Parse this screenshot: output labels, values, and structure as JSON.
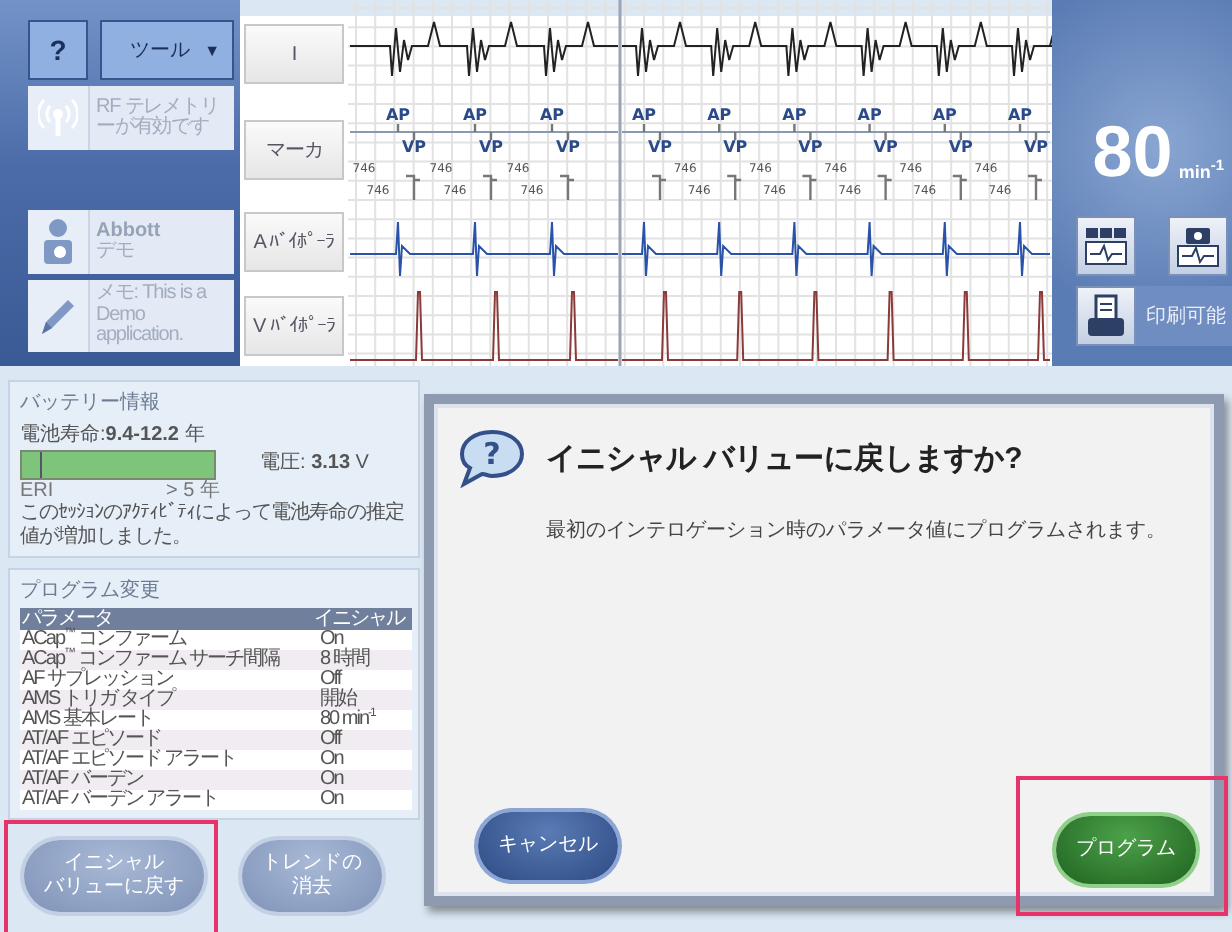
{
  "sidebar": {
    "help_button": "?",
    "tools_menu": {
      "label": "ツール",
      "caret": "▼"
    },
    "items": [
      {
        "kind": "telemetry",
        "text": "RF テレメトリーが有効です"
      },
      {
        "kind": "patient",
        "title": "Abbott",
        "text": "デモ"
      },
      {
        "kind": "note",
        "text": "メモ: This is a Demo application."
      }
    ]
  },
  "ecg": {
    "channels": [
      {
        "label": "I",
        "kind": "surface"
      },
      {
        "label": "マーカ",
        "kind": "marker"
      },
      {
        "label": "A ﾊﾞｲﾎﾟｰﾗ",
        "kind": "atrial"
      },
      {
        "label": "V ﾊﾞｲﾎﾟｰﾗ",
        "kind": "ventricular"
      }
    ],
    "segments": [
      {
        "beats": [
          {
            "atrial_marker": "AP",
            "ventricular_marker": "VP",
            "intervals": [
              "746",
              "746"
            ]
          },
          {
            "atrial_marker": "AP",
            "ventricular_marker": "VP",
            "intervals": [
              "746",
              "746"
            ]
          },
          {
            "atrial_marker": "AP",
            "ventricular_marker": "VP",
            "intervals": [
              "746",
              "746"
            ]
          }
        ]
      },
      {
        "beats": [
          {
            "atrial_marker": "AP",
            "ventricular_marker": "VP"
          },
          {
            "atrial_marker": "AP",
            "ventricular_marker": "VP",
            "intervals": [
              "746",
              "746"
            ]
          },
          {
            "atrial_marker": "AP",
            "ventricular_marker": "VP",
            "intervals": [
              "746",
              "746"
            ]
          },
          {
            "atrial_marker": "AP",
            "ventricular_marker": "VP",
            "intervals": [
              "746",
              "746"
            ]
          },
          {
            "atrial_marker": "AP",
            "ventricular_marker": "VP",
            "intervals": [
              "746",
              "746"
            ]
          },
          {
            "atrial_marker": "AP",
            "ventricular_marker": "VP",
            "intervals": [
              "746",
              "746"
            ]
          }
        ]
      }
    ]
  },
  "rate": {
    "value": "80",
    "unit": "min$^{-1}$"
  },
  "print": {
    "label": "印刷可能"
  },
  "battery": {
    "title": "バッテリー情報",
    "longevity": "電池寿命:**9.4-12.2** 年",
    "level": 1,
    "scale_min": "ERI",
    "scale_max": "> 5 年",
    "voltage": "電圧: **3.13** V",
    "note": "このｾｯｼｮﾝのｱｸﾃｨﾋﾞﾃｨによって電池寿命の推定値が増加しました。"
  },
  "program_changes": {
    "title": "プログラム変更",
    "columns": [
      "パラメータ",
      "イニシャル"
    ],
    "rows": [
      [
        "ACap$^{™}$ コンファーム",
        "On"
      ],
      [
        "ACap$^{™}$ コンファーム サーチ間隔",
        "8 時間"
      ],
      [
        "AF サプレッション",
        "Off"
      ],
      [
        "AMS トリガ タイプ",
        "開始"
      ],
      [
        "AMS 基本レート",
        "80 min$^{-1}$"
      ],
      [
        "AT/AF エピソード",
        "Off"
      ],
      [
        "AT/AF エピソード アラート",
        "On"
      ],
      [
        "AT/AF バーデン",
        "On"
      ],
      [
        "AT/AF バーデン アラート",
        "On"
      ]
    ]
  },
  "actions": [
    {
      "label_lines": [
        "イニシャル",
        "バリューに戻す"
      ],
      "highlighted": true
    },
    {
      "label_lines": [
        "トレンドの",
        "消去"
      ],
      "highlighted": false
    }
  ],
  "dialog": {
    "icon_glyph": "?",
    "title": "イニシャル バリューに戻しますか?",
    "message": "最初のインテロゲーション時のパラメータ値にプログラムされます。",
    "buttons": [
      {
        "label": "キャンセル",
        "kind": "cancel",
        "highlighted": false
      },
      {
        "label": "プログラム",
        "kind": "confirm",
        "highlighted": true
      }
    ]
  }
}
